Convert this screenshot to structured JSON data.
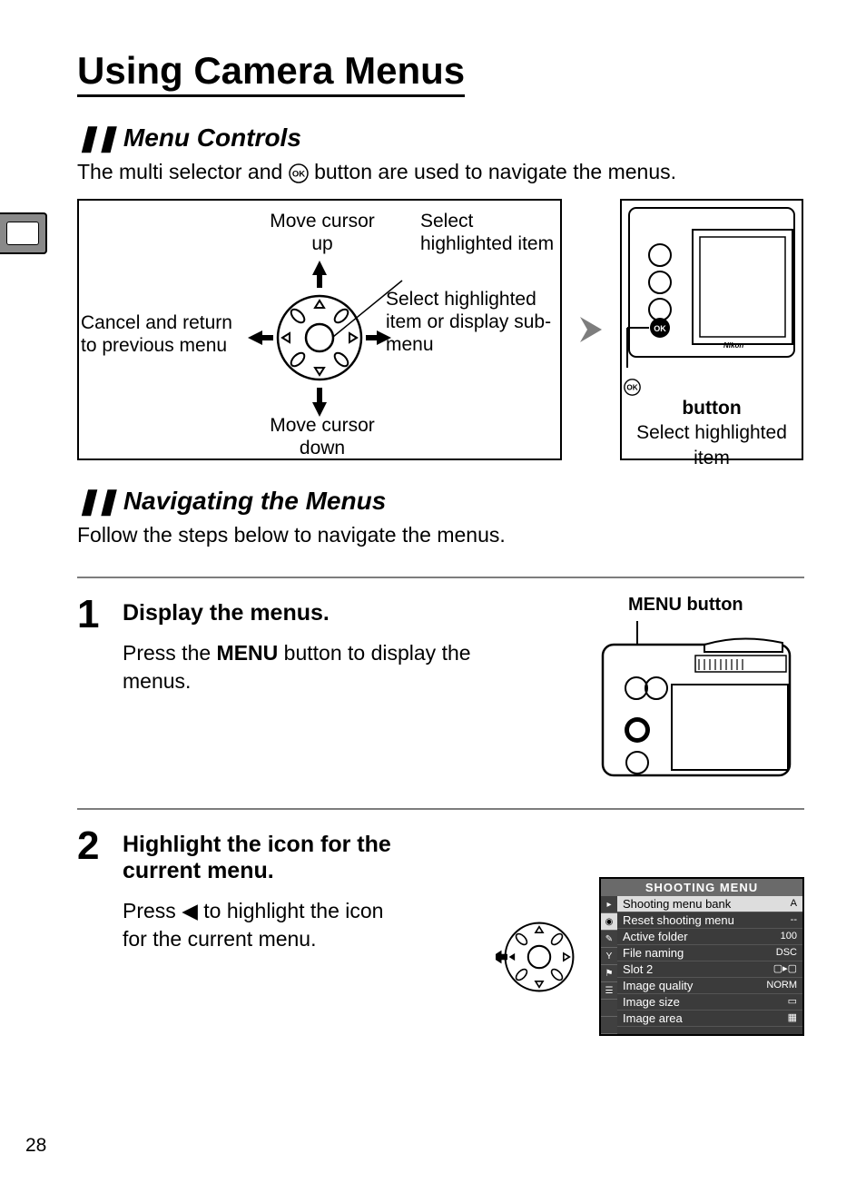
{
  "page_number": "28",
  "heading": "Using Camera Menus",
  "section1": {
    "title": "Menu Controls",
    "intro_before": "The multi selector and ",
    "intro_after": " button are used to navigate the menus."
  },
  "selector_labels": {
    "up": "Move cursor up",
    "down": "Move cursor down",
    "left": "Cancel and return to previous menu",
    "center": "Select highlighted item",
    "right": "Select highlighted item or display sub-menu"
  },
  "ok_caption": {
    "label": "button",
    "desc": "Select highlighted item"
  },
  "section2": {
    "title": "Navigating the Menus",
    "intro": "Follow the steps below to navigate the menus."
  },
  "steps": [
    {
      "num": "1",
      "title": "Display the menus.",
      "text_before": "Press the ",
      "menu_word": "MENU",
      "text_after": " button to display the menus.",
      "right_label_prefix": "MENU",
      "right_label_suffix": " button"
    },
    {
      "num": "2",
      "title": "Highlight the icon for the current menu.",
      "text_before": "Press ",
      "text_after": " to highlight the icon for the current menu."
    }
  ],
  "screen": {
    "title": "SHOOTING MENU",
    "rows": [
      {
        "label": "Shooting menu bank",
        "value": "A",
        "sel": true
      },
      {
        "label": "Reset shooting menu",
        "value": "--",
        "sel": false
      },
      {
        "label": "Active folder",
        "value": "100",
        "sel": false
      },
      {
        "label": "File naming",
        "value": "DSC",
        "sel": false
      },
      {
        "label": "Slot 2",
        "value": "▢▸▢",
        "sel": false
      },
      {
        "label": "Image quality",
        "value": "NORM",
        "sel": false
      },
      {
        "label": "Image size",
        "value": "▭",
        "sel": false
      },
      {
        "label": "Image area",
        "value": "▦",
        "sel": false
      }
    ]
  }
}
